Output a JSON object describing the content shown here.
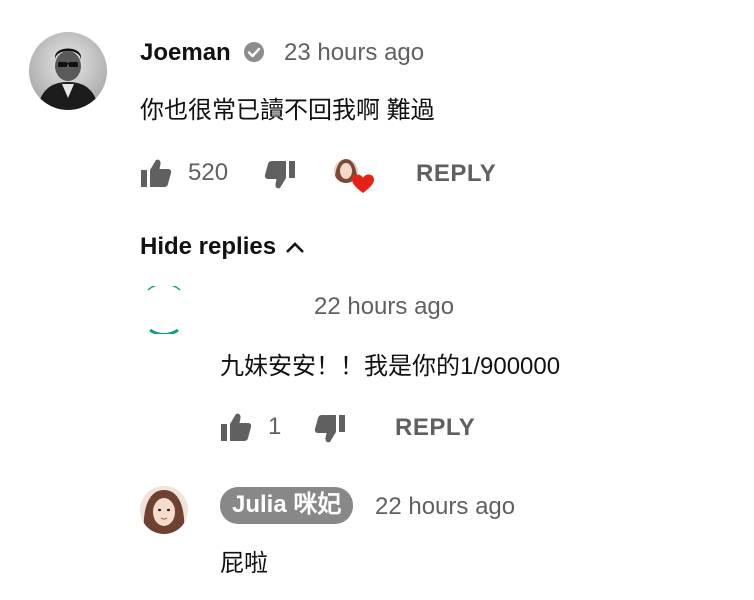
{
  "comment": {
    "author": "Joeman",
    "verified_icon": "verified-check-icon",
    "time": "23 hours ago",
    "text": "你也很常已讀不回我啊 難過",
    "likes": "520",
    "reply_label": "REPLY",
    "heart_icon": "creator-heart-icon"
  },
  "hide_replies_label": "Hide replies",
  "replies": [
    {
      "time": "22 hours ago",
      "text": "九妹安安！！我是你的1/900000",
      "likes": "1",
      "reply_label": "REPLY"
    },
    {
      "author": "Julia 咪妃",
      "time": "22 hours ago",
      "text": "屁啦"
    }
  ],
  "colors": {
    "text": "#0f0f0f",
    "secondary": "#606060",
    "heart": "#e62117",
    "author_chip": "#888888",
    "reply_avatar_ring": "#1a9a8e"
  }
}
